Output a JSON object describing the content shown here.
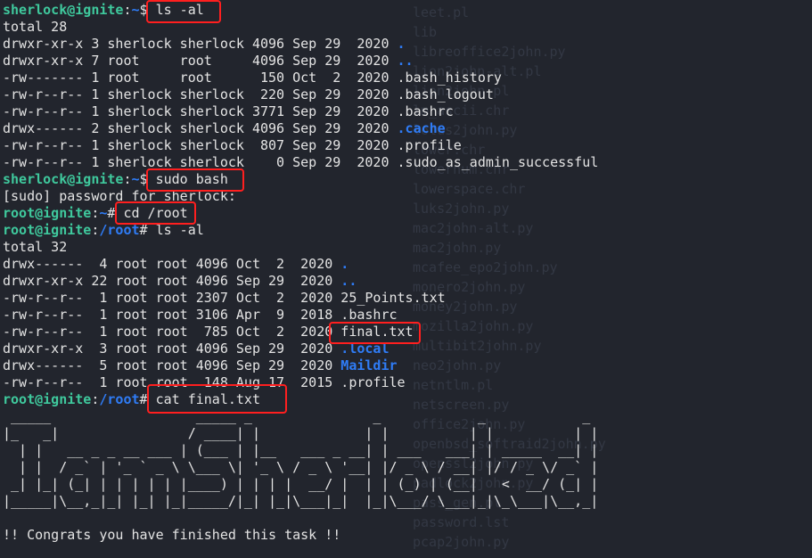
{
  "colors": {
    "background": "#22252d",
    "prompt_user": "#3fc99d",
    "path_and_dirs": "#2f7cf6",
    "text": "#e4e4e4",
    "highlight": "#ff1f1f"
  },
  "ghost_lines": [
    "leet.pl",
    "lib",
    "libreoffice2john.py",
    "lion2john-alt.pl",
    "lion2john.pl",
    "lm_ascii.chr",
    "lotus2john.py",
    "lower.chr",
    "lowernum.chr",
    "lowerspace.chr",
    "luks2john.py",
    "mac2john-alt.py",
    "mac2john.py",
    "mcafee_epo2john.py",
    "monero2john.py",
    "money2john.py",
    "mozilla2john.py",
    "multibit2john.py",
    "neo2john.py",
    "netntlm.pl",
    "netscreen.py",
    "office2john.py",
    "openbsd_softraid2john.py",
    "openssl2john.py",
    "padlock2john.py",
    "pass_gen.pl",
    "password.lst",
    "pcap2john.py"
  ],
  "terminal": {
    "lines": [
      [
        {
          "t": "sherlock@ignite",
          "c": "p"
        },
        {
          "t": ":",
          "c": "w"
        },
        {
          "t": "~",
          "c": "pb"
        },
        {
          "t": "$ ",
          "c": "w"
        },
        {
          "t": "ls -al",
          "c": "w"
        }
      ],
      [
        {
          "t": "total 28",
          "c": "w"
        }
      ],
      [
        {
          "t": "drwxr-xr-x 3 sherlock sherlock 4096 Sep 29  2020 ",
          "c": "w"
        },
        {
          "t": ".",
          "c": "b"
        }
      ],
      [
        {
          "t": "drwxr-xr-x 7 root     root     4096 Sep 29  2020 ",
          "c": "w"
        },
        {
          "t": "..",
          "c": "b"
        }
      ],
      [
        {
          "t": "-rw------- 1 root     root      150 Oct  2  2020 .bash_history",
          "c": "w"
        }
      ],
      [
        {
          "t": "-rw-r--r-- 1 sherlock sherlock  220 Sep 29  2020 .bash_logout",
          "c": "w"
        }
      ],
      [
        {
          "t": "-rw-r--r-- 1 sherlock sherlock 3771 Sep 29  2020 .bashrc",
          "c": "w"
        }
      ],
      [
        {
          "t": "drwx------ 2 sherlock sherlock 4096 Sep 29  2020 ",
          "c": "w"
        },
        {
          "t": ".cache",
          "c": "b"
        }
      ],
      [
        {
          "t": "-rw-r--r-- 1 sherlock sherlock  807 Sep 29  2020 .profile",
          "c": "w"
        }
      ],
      [
        {
          "t": "-rw-r--r-- 1 sherlock sherlock    0 Sep 29  2020 .sudo_as_admin_successful",
          "c": "w"
        }
      ],
      [
        {
          "t": "sherlock@ignite",
          "c": "p"
        },
        {
          "t": ":",
          "c": "w"
        },
        {
          "t": "~",
          "c": "pb"
        },
        {
          "t": "$ ",
          "c": "w"
        },
        {
          "t": "sudo bash",
          "c": "w"
        }
      ],
      [
        {
          "t": "[sudo] password for sherlock:",
          "c": "w"
        }
      ],
      [
        {
          "t": "root@ignite",
          "c": "p"
        },
        {
          "t": ":",
          "c": "w"
        },
        {
          "t": "~",
          "c": "pb"
        },
        {
          "t": "# ",
          "c": "w"
        },
        {
          "t": "cd /root",
          "c": "w"
        }
      ],
      [
        {
          "t": "root@ignite",
          "c": "p"
        },
        {
          "t": ":",
          "c": "w"
        },
        {
          "t": "/root",
          "c": "pb"
        },
        {
          "t": "# ",
          "c": "w"
        },
        {
          "t": "ls -al",
          "c": "w"
        }
      ],
      [
        {
          "t": "total 32",
          "c": "w"
        }
      ],
      [
        {
          "t": "drwx------  4 root root 4096 Oct  2  2020 ",
          "c": "w"
        },
        {
          "t": ".",
          "c": "b"
        }
      ],
      [
        {
          "t": "drwxr-xr-x 22 root root 4096 Sep 29  2020 ",
          "c": "w"
        },
        {
          "t": "..",
          "c": "b"
        }
      ],
      [
        {
          "t": "-rw-r--r--  1 root root 2307 Oct  2  2020 25_Points.txt",
          "c": "w"
        }
      ],
      [
        {
          "t": "-rw-r--r--  1 root root 3106 Apr  9  2018 .bashrc",
          "c": "w"
        }
      ],
      [
        {
          "t": "-rw-r--r--  1 root root  785 Oct  2  2020 final.txt",
          "c": "w"
        }
      ],
      [
        {
          "t": "drwxr-xr-x  3 root root 4096 Sep 29  2020 ",
          "c": "w"
        },
        {
          "t": ".local",
          "c": "b"
        }
      ],
      [
        {
          "t": "drwx------  5 root root 4096 Sep 29  2020 ",
          "c": "w"
        },
        {
          "t": "Maildir",
          "c": "b"
        }
      ],
      [
        {
          "t": "-rw-r--r--  1 root root  148 Aug 17  2015 .profile",
          "c": "w"
        }
      ],
      [
        {
          "t": "root@ignite",
          "c": "p"
        },
        {
          "t": ":",
          "c": "w"
        },
        {
          "t": "/root",
          "c": "pb"
        },
        {
          "t": "# ",
          "c": "w"
        },
        {
          "t": "cat final.txt",
          "c": "w"
        }
      ],
      [
        {
          "t": " _____                  _____ _               _            _            _ ",
          "c": "art"
        }
      ],
      [
        {
          "t": "|_   _|                / ____| |             | |          | |          | |",
          "c": "art"
        }
      ],
      [
        {
          "t": "  | |   __ _ _ __ ___ | (___ | |__   ___ _ __| | ___   ___| | _____  __| |",
          "c": "art"
        }
      ],
      [
        {
          "t": "  | |  / _` | '_ ` _ \\ \\___ \\| '_ \\ / _ \\ '__| |/ _ \\ / __| |/ / _ \\/ _` |",
          "c": "art"
        }
      ],
      [
        {
          "t": " _| |_| (_| | | | | | |____) | | | |  __/ |  | | (_) | (__|   <  __/ (_| |",
          "c": "art"
        }
      ],
      [
        {
          "t": "|_____|\\__,_|_| |_| |_|_____/|_| |_|\\___|_|  |_|\\___/ \\___|_|\\_\\___|\\__,_|",
          "c": "art"
        }
      ],
      [],
      [
        {
          "t": "!! Congrats you have finished this task !!",
          "c": "w"
        }
      ]
    ]
  }
}
